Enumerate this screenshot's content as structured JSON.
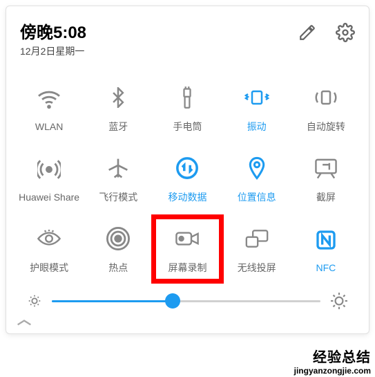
{
  "header": {
    "time": "傍晚5:08",
    "date": "12月2日星期一"
  },
  "tiles": [
    {
      "id": "wlan",
      "label": "WLAN",
      "active": false
    },
    {
      "id": "bluetooth",
      "label": "蓝牙",
      "active": false
    },
    {
      "id": "flashlight",
      "label": "手电筒",
      "active": false
    },
    {
      "id": "vibrate",
      "label": "振动",
      "active": true
    },
    {
      "id": "auto-rotate",
      "label": "自动旋转",
      "active": false
    },
    {
      "id": "huawei-share",
      "label": "Huawei Share",
      "active": false
    },
    {
      "id": "airplane",
      "label": "飞行模式",
      "active": false
    },
    {
      "id": "mobile-data",
      "label": "移动数据",
      "active": true
    },
    {
      "id": "location",
      "label": "位置信息",
      "active": true
    },
    {
      "id": "screenshot",
      "label": "截屏",
      "active": false
    },
    {
      "id": "eye-comfort",
      "label": "护眼模式",
      "active": false
    },
    {
      "id": "hotspot",
      "label": "热点",
      "active": false
    },
    {
      "id": "screen-record",
      "label": "屏幕录制",
      "active": false,
      "highlight": true
    },
    {
      "id": "wireless-proj",
      "label": "无线投屏",
      "active": false
    },
    {
      "id": "nfc",
      "label": "NFC",
      "active": true
    }
  ],
  "brightness": {
    "value": 45
  },
  "watermark": {
    "line1": "经验总结",
    "line2": "jingyanzongjie.com"
  },
  "colors": {
    "active": "#1d9bf0",
    "inactive": "#666666"
  }
}
